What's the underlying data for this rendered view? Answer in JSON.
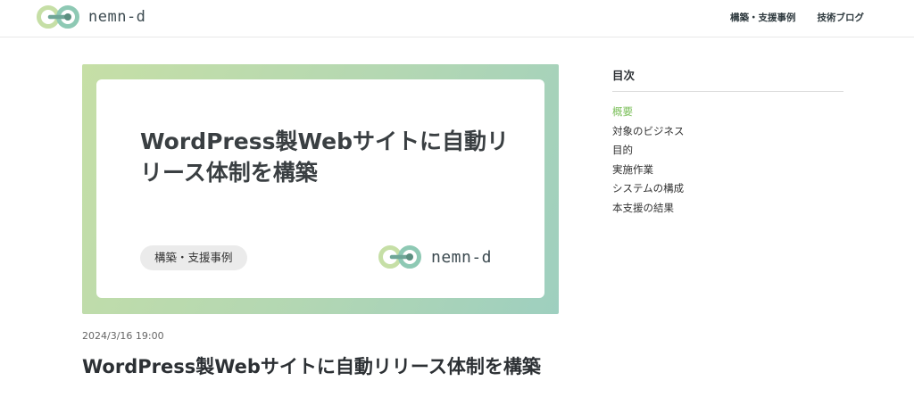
{
  "site": {
    "logo_text": "nemn-d",
    "colors": {
      "accent_green": "#7bbf5a",
      "logo_light": "#c6dfa6",
      "logo_teal": "#8ec9b4"
    }
  },
  "nav": {
    "items": [
      {
        "label": "構築・支援事例"
      },
      {
        "label": "技術ブログ"
      }
    ]
  },
  "hero": {
    "title": "WordPress製Webサイトに自動リリース体制を構築",
    "tag": "構築・支援事例",
    "logo_text": "nemn-d"
  },
  "post": {
    "date": "2024/3/16 19:00",
    "title": "WordPress製Webサイトに自動リリース体制を構築"
  },
  "toc": {
    "heading": "目次",
    "items": [
      {
        "label": "概要",
        "active": true
      },
      {
        "label": "対象のビジネス",
        "active": false
      },
      {
        "label": "目的",
        "active": false
      },
      {
        "label": "実施作業",
        "active": false
      },
      {
        "label": "システムの構成",
        "active": false
      },
      {
        "label": "本支援の結果",
        "active": false
      }
    ]
  }
}
